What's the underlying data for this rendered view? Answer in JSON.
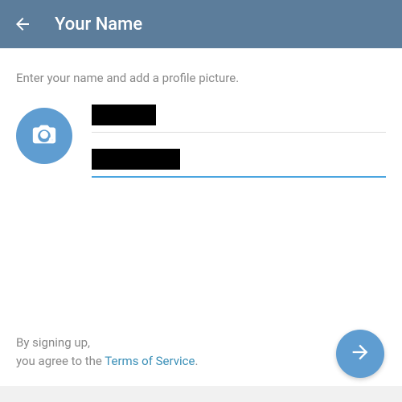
{
  "header": {
    "title": "Your Name"
  },
  "instruction": "Enter your name and add a profile picture.",
  "fields": {
    "first_name": "",
    "last_name": ""
  },
  "footer": {
    "line1": "By signing up,",
    "line2_prefix": "you agree to the ",
    "tos_label": "Terms of Service",
    "line2_suffix": "."
  },
  "colors": {
    "header_bg": "#5c7d9b",
    "accent": "#5f9dd1",
    "link": "#3a8fb7"
  }
}
